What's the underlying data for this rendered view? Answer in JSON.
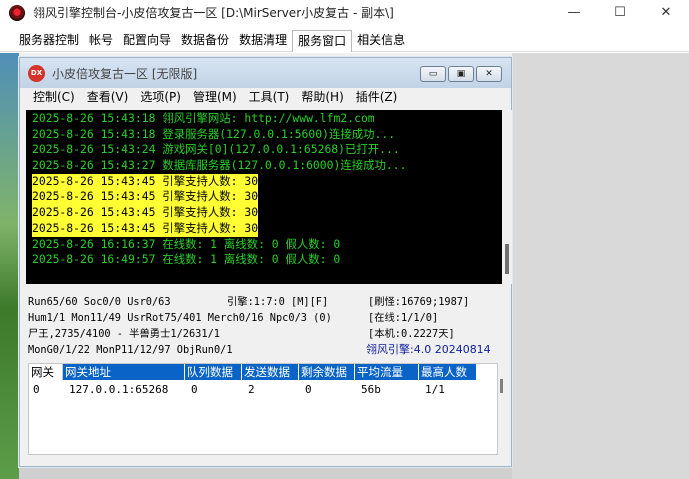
{
  "app": {
    "title": "翎风引擎控制台-小皮倍攻复古一区 [D:\\MirServer小皮复古 - 副本\\]"
  },
  "window_controls": {
    "minimize": "—",
    "maximize": "☐",
    "close": "✕"
  },
  "main_tabs": [
    {
      "label": "服务器控制"
    },
    {
      "label": "帐号"
    },
    {
      "label": "配置向导"
    },
    {
      "label": "数据备份"
    },
    {
      "label": "数据清理"
    },
    {
      "label": "服务窗口"
    },
    {
      "label": "相关信息"
    }
  ],
  "inner": {
    "icon_text": "DX",
    "title": "小皮倍攻复古一区 [无限版]",
    "btn_min": "▭",
    "btn_max": "▣",
    "btn_close": "✕"
  },
  "inner_menu": [
    {
      "label": "控制(C)"
    },
    {
      "label": "查看(V)"
    },
    {
      "label": "选项(P)"
    },
    {
      "label": "管理(M)"
    },
    {
      "label": "工具(T)"
    },
    {
      "label": "帮助(H)"
    },
    {
      "label": "插件(Z)"
    }
  ],
  "log": [
    {
      "text": "2025-8-26 15:43:18 翎风引擎网站: http://www.lfm2.com",
      "highlight": false
    },
    {
      "text": "2025-8-26 15:43:18 登录服务器(127.0.0.1:5600)连接成功...",
      "highlight": false
    },
    {
      "text": "2025-8-26 15:43:24 游戏网关[0](127.0.0.1:65268)已打开...",
      "highlight": false
    },
    {
      "text": "2025-8-26 15:43:27 数据库服务器(127.0.0.1:6000)连接成功...",
      "highlight": false
    },
    {
      "text": "2025-8-26 15:43:45 引擎支持人数: 30",
      "highlight": true
    },
    {
      "text": "2025-8-26 15:43:45 引擎支持人数: 30",
      "highlight": true
    },
    {
      "text": "2025-8-26 15:43:45 引擎支持人数: 30",
      "highlight": true
    },
    {
      "text": "2025-8-26 15:43:45 引擎支持人数: 30",
      "highlight": true
    },
    {
      "text": "2025-8-26 16:16:37 在线数: 1 离线数: 0 假人数: 0",
      "highlight": false
    },
    {
      "text": "2025-8-26 16:49:57 在线数: 1 离线数: 0 假人数: 0",
      "highlight": false
    }
  ],
  "status": {
    "run": "Run65/60 Soc0/0 Usr0/63",
    "engine": "引擎:1:7:0 [M][F]",
    "refresh": "[刷怪:16769;1987]",
    "hum": "Hum1/1 Mon11/49 UsrRot75/401 Merch0/16 Npc0/3 (0)",
    "online": "[在线:1/1/0]",
    "corpse": "尸王,2735/4100 - 半兽勇士1/2631/1",
    "local": "[本机:0.2227天]",
    "mongo": "MonG0/1/22 MonP11/12/97 ObjRun0/1",
    "version": "翎风引擎:4.0 20240814"
  },
  "gateway_table": {
    "columns": [
      "网关",
      "网关地址",
      "队列数据",
      "发送数据",
      "剩余数据",
      "平均流量",
      "最高人数"
    ],
    "rows": [
      [
        "0",
        "127.0.0.1:65268",
        "0",
        "2",
        "0",
        "56b",
        "1/1"
      ]
    ]
  }
}
